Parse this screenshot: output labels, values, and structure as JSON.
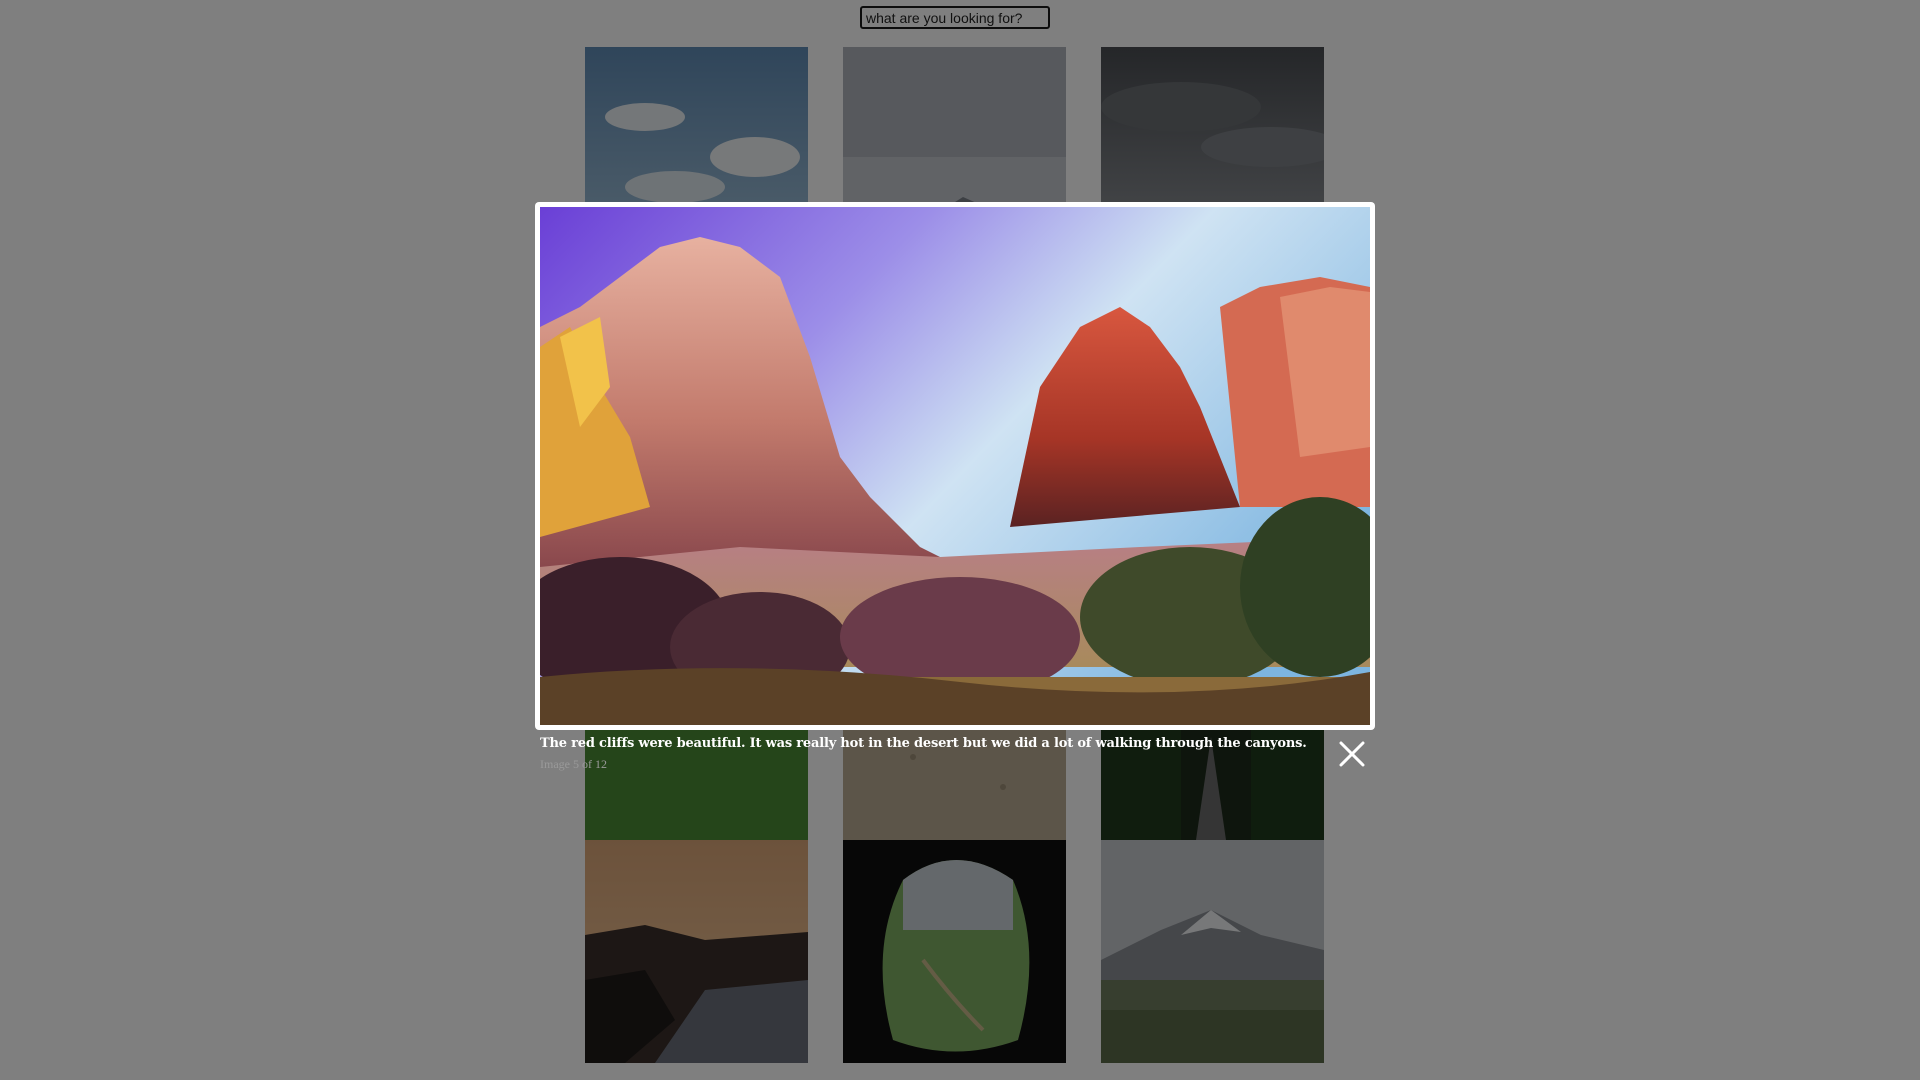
{
  "search": {
    "placeholder": "what are you looking for?"
  },
  "gallery": {
    "thumbnails": [
      {
        "icon": "sky-clouds-meadow-photo"
      },
      {
        "icon": "misty-mountain-photo"
      },
      {
        "icon": "overcast-plain-photo"
      },
      {
        "icon": "green-field-photo"
      },
      {
        "icon": "sand-texture-photo"
      },
      {
        "icon": "forest-path-photo"
      },
      {
        "icon": "sunset-coast-photo"
      },
      {
        "icon": "cave-valley-photo"
      },
      {
        "icon": "snowy-mountain-meadow-photo"
      }
    ]
  },
  "lightbox": {
    "image_icon": "red-cliffs-canyon-photo",
    "caption": "The red cliffs were beautiful. It was really hot in the desert but we did a lot of walking through the canyons.",
    "counter": "Image 5 of 12",
    "close_icon": "close-icon"
  },
  "colors": {
    "overlay": "rgba(0,0,0,0.5)",
    "lightbox_border": "#ffffff",
    "caption_text": "#ffffff",
    "counter_text": "#9a9a9a"
  }
}
